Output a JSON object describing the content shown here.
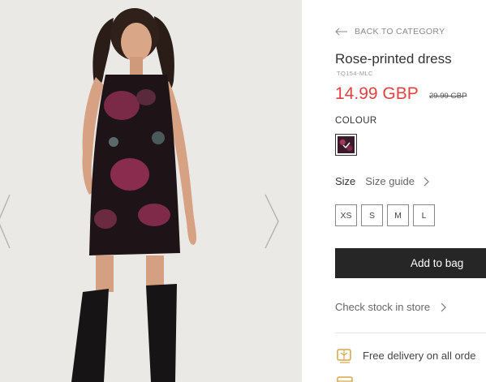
{
  "product": {
    "back_label": "BACK TO CATEGORY",
    "title": "Rose-printed dress",
    "sku": "TQ154-MLC",
    "price": "14.99 GBP",
    "old_price": "29.99 GBP",
    "colour_label": "COLOUR",
    "size_label": "Size",
    "size_guide_label": "Size guide",
    "sizes": [
      "XS",
      "S",
      "M",
      "L"
    ],
    "add_to_bag_label": "Add to bag",
    "check_stock_label": "Check stock in store",
    "delivery_label": "Free delivery on all orde"
  },
  "colors": {
    "price": "#e0423f",
    "button": "#262626",
    "delivery_icon": "#d9a64a"
  },
  "icons": {
    "back": "arrow-left-icon",
    "nav_prev": "chevron-left-icon",
    "nav_next": "chevron-right-icon",
    "delivery": "truck-icon"
  }
}
